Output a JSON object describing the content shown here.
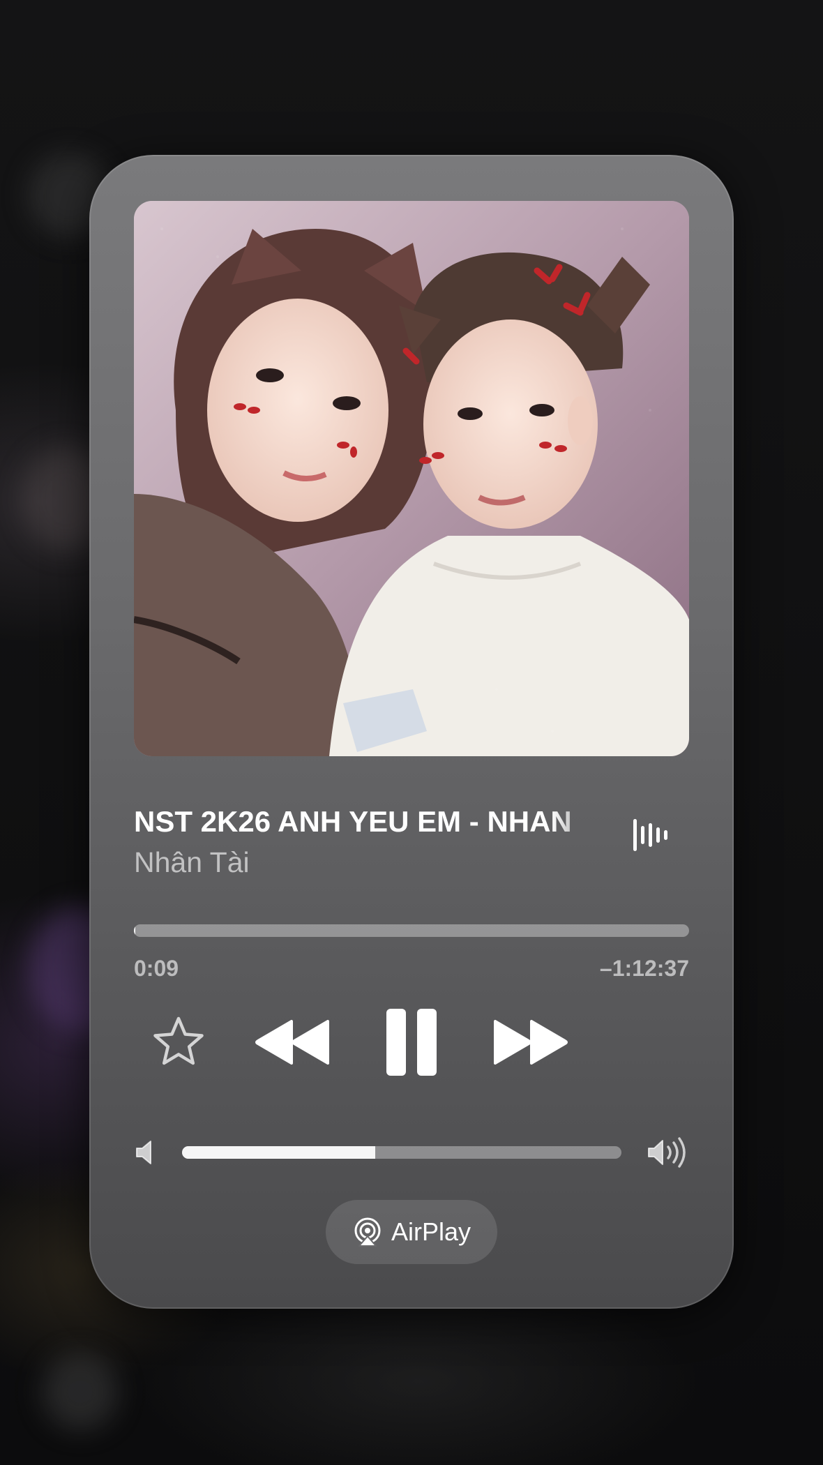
{
  "now_playing": {
    "title": "NST 2K26 ANH YEU EM - NHAN",
    "artist": "Nhân Tài",
    "elapsed": "0:09",
    "remaining": "–1:12:37",
    "progress_fraction": 0.002,
    "volume_fraction": 0.44
  },
  "controls": {
    "favorite_icon": "star-icon",
    "rewind_icon": "rewind-icon",
    "pause_icon": "pause-icon",
    "forward_icon": "fast-forward-icon",
    "waveform_icon": "waveform-icon",
    "volume_low_icon": "speaker-low-icon",
    "volume_high_icon": "speaker-high-icon"
  },
  "airplay": {
    "label": "AirPlay",
    "icon": "airplay-icon"
  },
  "colors": {
    "card_top": "#7a7a7c",
    "card_bottom": "#4a4a4c",
    "text_primary": "#ffffff",
    "text_secondary": "rgba(255,255,255,0.62)"
  }
}
